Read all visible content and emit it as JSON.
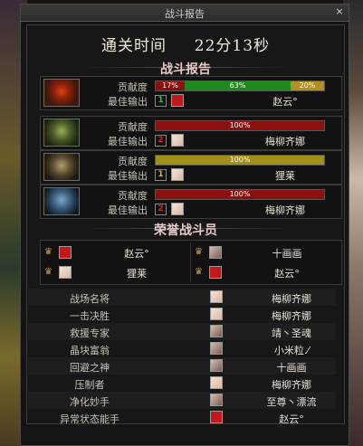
{
  "window": {
    "title": "战斗报告",
    "close_label": "×"
  },
  "clear_time": {
    "label": "通关时间",
    "value": "22分13秒"
  },
  "battle_report": {
    "title": "战斗报告",
    "contribution_label": "贡献度",
    "best_dps_label": "最佳输出",
    "players": [
      {
        "avatar": "red-flame-avatar",
        "bar": [
          {
            "text": "17%",
            "value": 17,
            "color": "#8b1010"
          },
          {
            "text": "63%",
            "value": 63,
            "color": "#1e8a1e"
          },
          {
            "text": "20%",
            "value": 20,
            "color": "#b09020"
          }
        ],
        "rank": "1",
        "rank_color": "#2bbf2b",
        "best_name": "赵云°",
        "best_face": "red"
      },
      {
        "avatar": "green-helm-avatar",
        "bar": [
          {
            "text": "100%",
            "value": 100,
            "color": "#8b1010"
          }
        ],
        "rank": "2",
        "rank_color": "#e02020",
        "best_name": "梅柳齐娜",
        "best_face": "light"
      },
      {
        "avatar": "gold-helm-avatar",
        "bar": [
          {
            "text": "100%",
            "value": 100,
            "color": "#a09018"
          }
        ],
        "rank": "1",
        "rank_color": "#d4b030",
        "best_name": "狸莱",
        "best_face": "light"
      },
      {
        "avatar": "blue-helm-avatar",
        "bar": [
          {
            "text": "100%",
            "value": 100,
            "color": "#8b1010"
          }
        ],
        "rank": "2",
        "rank_color": "#e02020",
        "best_name": "梅柳齐娜",
        "best_face": "light"
      }
    ]
  },
  "honor": {
    "title": "荣誉战斗员",
    "cells": [
      {
        "name": "赵云°",
        "face": "red"
      },
      {
        "name": "十画画",
        "face": "mixed"
      },
      {
        "name": "狸莱",
        "face": "light"
      },
      {
        "name": "赵云°",
        "face": "red"
      }
    ]
  },
  "awards": [
    {
      "title": "战场名将",
      "name": "梅柳齐娜",
      "face": "light"
    },
    {
      "title": "一击决胜",
      "name": "梅柳齐娜",
      "face": "light"
    },
    {
      "title": "救援专家",
      "name": "靖丶圣魂",
      "face": "mixed"
    },
    {
      "title": "晶块富翁",
      "name": "小米粒.⁄",
      "face": "mixed"
    },
    {
      "title": "回避之神",
      "name": "十画画",
      "face": "mixed"
    },
    {
      "title": "压制者",
      "name": "梅柳齐娜",
      "face": "light"
    },
    {
      "title": "净化妙手",
      "name": "至尊丶漂流",
      "face": "mixed"
    },
    {
      "title": "异常状态能手",
      "name": "赵云°",
      "face": "red"
    }
  ]
}
